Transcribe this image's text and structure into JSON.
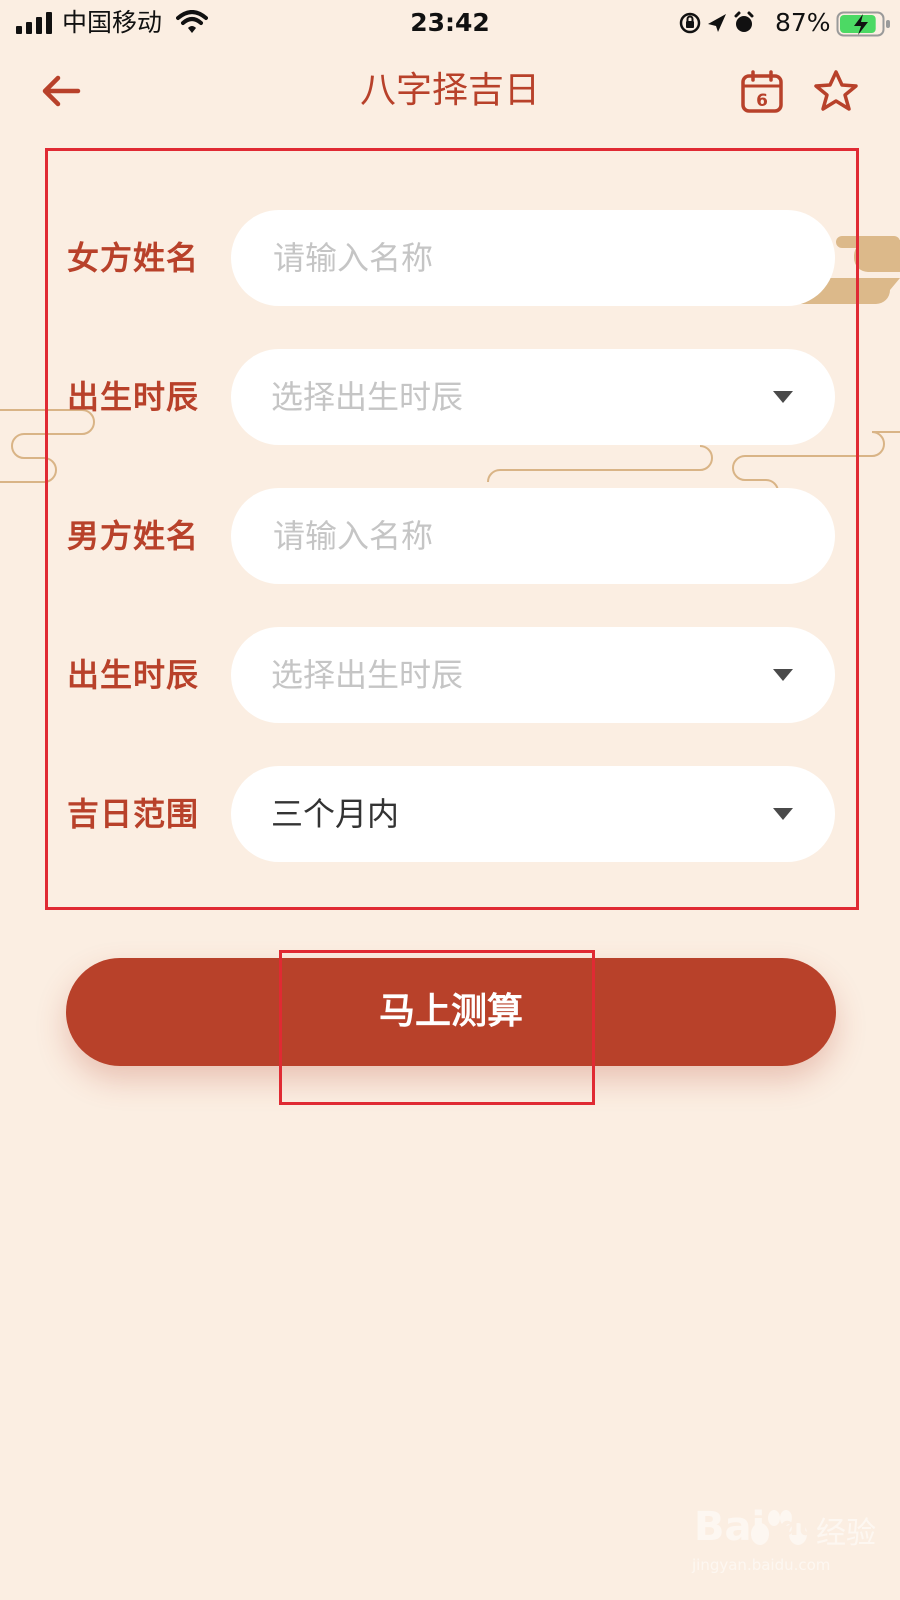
{
  "status_bar": {
    "carrier": "中国移动",
    "time": "23:42",
    "battery_percent": "87%",
    "battery_level": 0.87
  },
  "nav": {
    "title": "八字择吉日",
    "calendar_day": "6"
  },
  "form": {
    "rows": [
      {
        "label": "女方姓名",
        "kind": "input",
        "placeholder": "请输入名称",
        "value": ""
      },
      {
        "label": "出生时辰",
        "kind": "select",
        "placeholder": "选择出生时辰",
        "value": ""
      },
      {
        "label": "男方姓名",
        "kind": "input",
        "placeholder": "请输入名称",
        "value": ""
      },
      {
        "label": "出生时辰",
        "kind": "select",
        "placeholder": "选择出生时辰",
        "value": ""
      },
      {
        "label": "吉日范围",
        "kind": "select",
        "placeholder": "",
        "value": "三个月内"
      }
    ]
  },
  "submit": {
    "label": "马上测算"
  },
  "watermark": {
    "brand": "Bai",
    "brand_suffix": "du",
    "product": "经验",
    "domain": "jingyan.baidu.com"
  },
  "colors": {
    "background": "#fbeee2",
    "accent": "#b8412a",
    "highlight_box": "#e02a33",
    "placeholder": "#c5c5c5"
  },
  "icons": {
    "back": "arrow-left-icon",
    "calendar": "calendar-icon",
    "favorite": "star-icon",
    "dropdown": "caret-down-icon"
  }
}
